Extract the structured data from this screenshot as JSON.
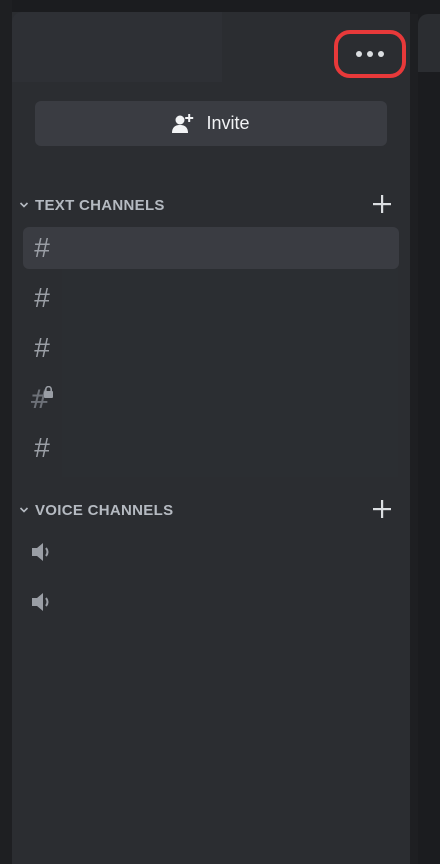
{
  "header": {
    "more_label": "More options"
  },
  "invite": {
    "label": "Invite"
  },
  "categories": [
    {
      "label": "TEXT CHANNELS",
      "channels": [
        {
          "icon": "hash-icon",
          "label": "",
          "selected": true
        },
        {
          "icon": "hash-icon",
          "label": ""
        },
        {
          "icon": "hash-icon",
          "label": ""
        },
        {
          "icon": "hash-lock-icon",
          "label": ""
        },
        {
          "icon": "hash-icon",
          "label": ""
        }
      ]
    },
    {
      "label": "VOICE CHANNELS",
      "channels": [
        {
          "icon": "speaker-icon",
          "label": ""
        },
        {
          "icon": "speaker-icon",
          "label": ""
        }
      ]
    }
  ],
  "colors": {
    "background": "#1e1f22",
    "panel": "#2b2d31",
    "button": "#3a3c42",
    "highlight_ring": "#e8393a",
    "text_muted": "#b5bac1",
    "text_bright": "#f2f3f5"
  }
}
